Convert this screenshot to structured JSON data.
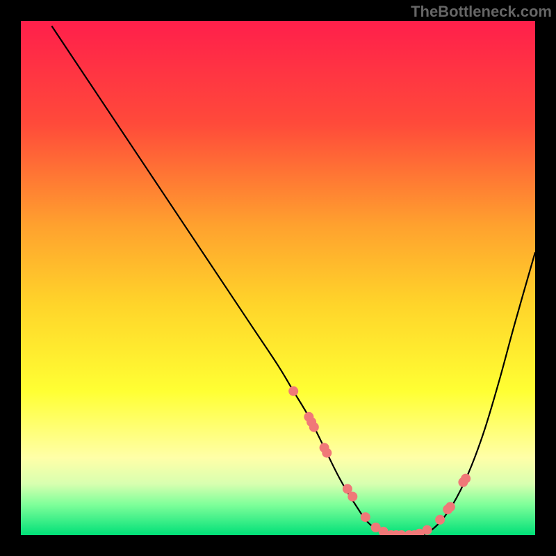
{
  "watermark": "TheBottleneck.com",
  "chart_data": {
    "type": "line",
    "title": "",
    "xlabel": "",
    "ylabel": "",
    "xlim": [
      0,
      100
    ],
    "ylim": [
      0,
      100
    ],
    "background_gradient_stops": [
      {
        "offset": 0.0,
        "color": "#ff1f4b"
      },
      {
        "offset": 0.2,
        "color": "#ff4a3a"
      },
      {
        "offset": 0.4,
        "color": "#ffa22e"
      },
      {
        "offset": 0.55,
        "color": "#ffd42a"
      },
      {
        "offset": 0.72,
        "color": "#ffff33"
      },
      {
        "offset": 0.85,
        "color": "#ffffa8"
      },
      {
        "offset": 0.9,
        "color": "#d8ffb0"
      },
      {
        "offset": 0.94,
        "color": "#80ff9a"
      },
      {
        "offset": 1.0,
        "color": "#00e078"
      }
    ],
    "series": [
      {
        "name": "bottleneck-curve",
        "color": "#000000",
        "x": [
          6,
          10,
          15,
          20,
          25,
          30,
          35,
          40,
          45,
          50,
          53,
          56,
          59,
          62,
          65,
          68,
          72,
          75,
          78,
          81,
          84,
          87,
          90,
          93,
          96,
          100
        ],
        "y": [
          99,
          93,
          85.5,
          78,
          70.5,
          63,
          55.5,
          48,
          40.5,
          33,
          28,
          23,
          17,
          11,
          6,
          2,
          0,
          0,
          0,
          2,
          6,
          12,
          20,
          30,
          41,
          55
        ]
      }
    ],
    "scatter_points": {
      "name": "marked-points",
      "color": "#f07878",
      "radius_px": 7,
      "x": [
        53,
        56,
        56.5,
        57,
        59,
        59.5,
        63.5,
        64.5,
        67,
        69,
        70.5,
        72,
        73,
        74,
        75.5,
        76.5,
        77.5,
        79,
        81.5,
        83,
        83.5,
        86,
        86.5
      ],
      "y": [
        28,
        23,
        22,
        21,
        17,
        16,
        9,
        7.5,
        3.5,
        1.5,
        0.7,
        0,
        0,
        0,
        0,
        0,
        0.3,
        1,
        3,
        5,
        5.5,
        10.3,
        11
      ]
    }
  }
}
